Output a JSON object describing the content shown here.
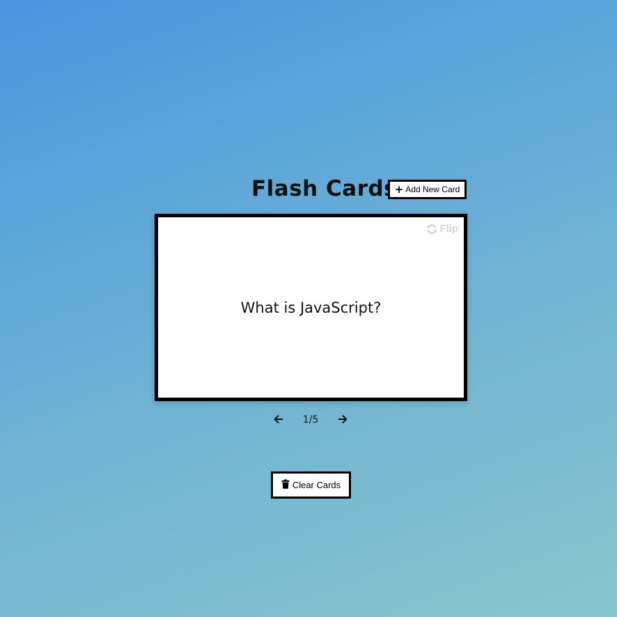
{
  "header": {
    "title": "Flash Cards",
    "add_button_icon": "plus-icon",
    "add_button_label": "Add New Card"
  },
  "card": {
    "text": "What is JavaScript?",
    "flip_icon": "refresh-icon",
    "flip_label": "Flip"
  },
  "navigation": {
    "prev_icon": "arrow-left-icon",
    "counter": "1/5",
    "next_icon": "arrow-right-icon"
  },
  "footer": {
    "clear_button_icon": "trash-icon",
    "clear_button_label": "Clear Cards"
  },
  "colors": {
    "background_top": "#4a95de",
    "background_bottom": "#86c5cc",
    "card_border": "#000000",
    "flip_text": "#d4d4d4"
  }
}
